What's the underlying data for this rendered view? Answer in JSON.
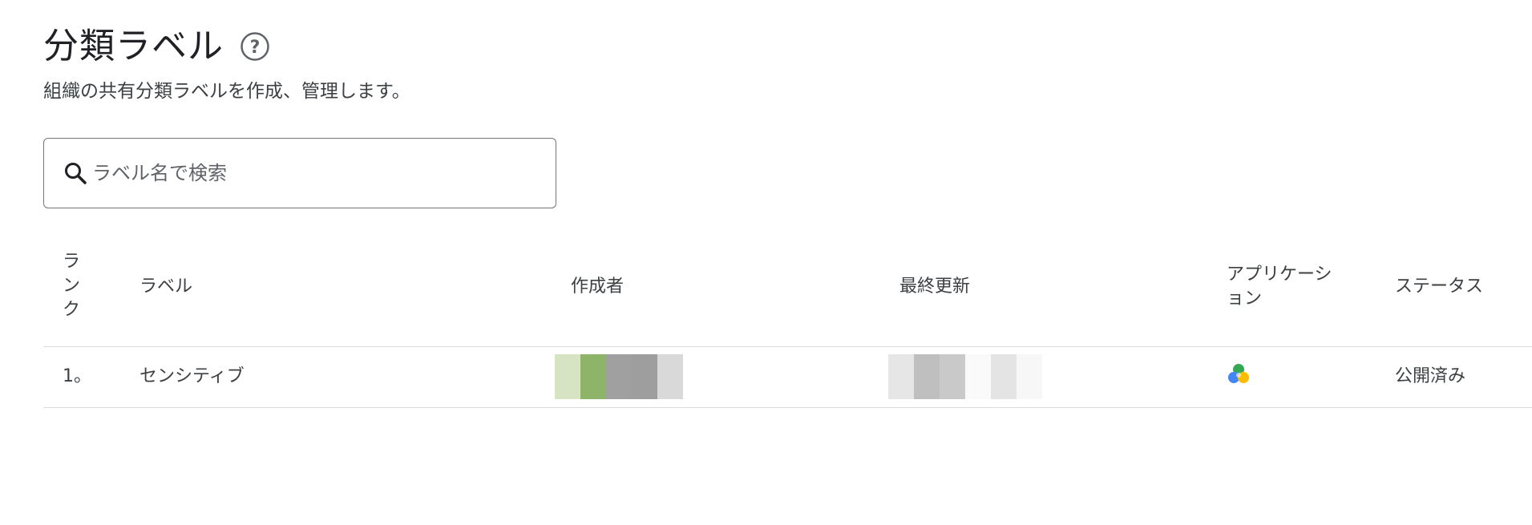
{
  "header": {
    "title": "分類ラベル",
    "help_icon": "help-circle-icon",
    "subtitle": "組織の共有分類ラベルを作成、管理します。"
  },
  "search": {
    "icon": "search-icon",
    "placeholder": "ラベル名で検索",
    "value": ""
  },
  "table": {
    "columns": {
      "rank": "ランク",
      "label": "ラベル",
      "author": "作成者",
      "updated": "最終更新",
      "apps": "アプリケーション",
      "status": "ステータス"
    },
    "rows": [
      {
        "rank": "1。",
        "label": "センシティブ",
        "author": "",
        "updated": "",
        "app_icon": "google-drive-icon",
        "status": "公開済み"
      }
    ]
  },
  "colors": {
    "text_primary": "#202124",
    "text_secondary": "#3c4043",
    "border": "#dadce0",
    "search_border": "#747775",
    "drive_green": "#34a853",
    "drive_blue": "#4285f4",
    "drive_yellow": "#fbbc04"
  }
}
